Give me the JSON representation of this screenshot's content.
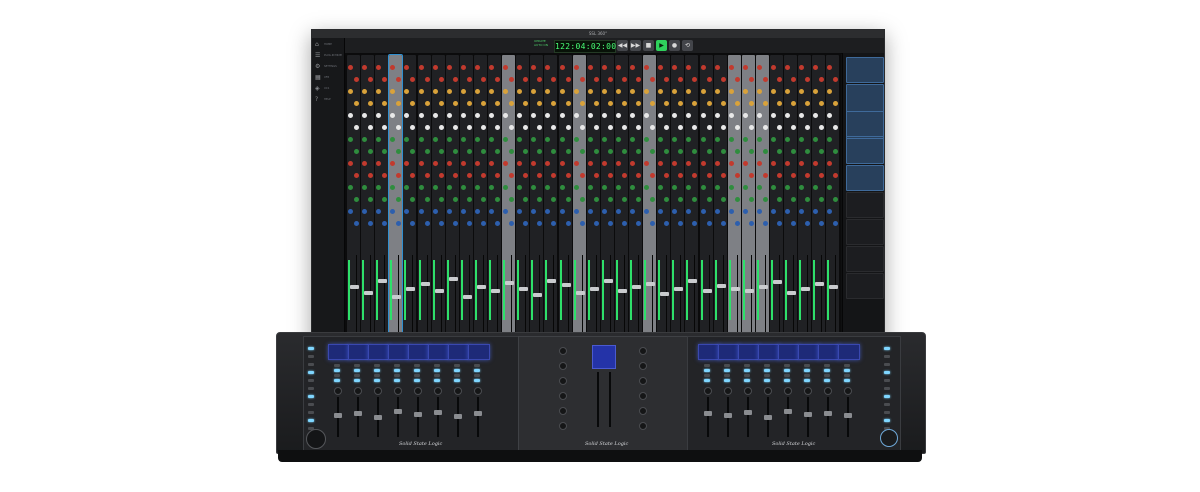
{
  "window": {
    "title": "SSL 360°"
  },
  "transport": {
    "timecode": "122:04:02:005",
    "flags": [
      "UPDATE",
      "AUTO ON"
    ],
    "buttons": [
      {
        "name": "rewind",
        "glyph": "◀◀",
        "active": false
      },
      {
        "name": "fast-forward",
        "glyph": "▶▶",
        "active": false
      },
      {
        "name": "stop",
        "glyph": "■",
        "active": false
      },
      {
        "name": "play",
        "glyph": "▶",
        "active": true
      },
      {
        "name": "record",
        "glyph": "●",
        "active": false
      },
      {
        "name": "loop",
        "glyph": "⟲",
        "active": false
      }
    ]
  },
  "sidebar": {
    "items": [
      {
        "icon": "home-icon",
        "glyph": "⌂",
        "label": "HOME"
      },
      {
        "icon": "mixer-icon",
        "glyph": "☰",
        "label": "PLUG-IN MIXER"
      },
      {
        "icon": "settings-icon",
        "glyph": "⚙",
        "label": "SETTINGS"
      },
      {
        "icon": "uf8-icon",
        "glyph": "▦",
        "label": "UF8"
      },
      {
        "icon": "uc1-icon",
        "glyph": "◈",
        "label": "UC1"
      },
      {
        "icon": "help-icon",
        "glyph": "?",
        "label": "HELP"
      }
    ]
  },
  "mixer": {
    "strip_shades": [
      "dark",
      "dark",
      "dark",
      "light",
      "dark",
      "dark",
      "dark",
      "dark",
      "dark",
      "dark",
      "dark",
      "light",
      "dark",
      "dark",
      "dark",
      "dark",
      "light",
      "dark",
      "dark",
      "dark",
      "dark",
      "light",
      "dark",
      "dark",
      "dark",
      "dark",
      "dark",
      "light",
      "light",
      "light",
      "dark",
      "dark",
      "dark",
      "dark",
      "dark"
    ],
    "selected_strip": 3,
    "knob_colors": [
      "#c23a2e",
      "#2f8d3e",
      "#2d5fae",
      "#e8e8e8",
      "#d9a23a"
    ],
    "fader_levels": [
      0.62,
      0.55,
      0.7,
      0.5,
      0.6,
      0.66,
      0.58,
      0.72,
      0.5,
      0.63,
      0.57,
      0.68,
      0.6,
      0.52,
      0.7,
      0.65,
      0.55,
      0.6,
      0.7,
      0.58,
      0.62,
      0.66,
      0.54,
      0.6,
      0.7,
      0.58,
      0.64,
      0.6,
      0.57,
      0.63,
      0.69,
      0.55,
      0.6,
      0.66,
      0.62
    ]
  },
  "plugin_panel": {
    "slots": [
      {
        "filled": true
      },
      {
        "filled": true
      },
      {
        "filled": true
      },
      {
        "filled": true
      },
      {
        "filled": true
      },
      {
        "filled": false
      },
      {
        "filled": false
      },
      {
        "filled": false
      },
      {
        "filled": false
      }
    ]
  },
  "hardware": {
    "brand_left": "Solid State Logic",
    "brand_center": "Solid State Logic",
    "brand_right": "Solid State Logic",
    "left_fader_levels": [
      0.55,
      0.6,
      0.5,
      0.65,
      0.58,
      0.62,
      0.52,
      0.6
    ],
    "right_fader_levels": [
      0.6,
      0.55,
      0.62,
      0.5,
      0.66,
      0.58,
      0.6,
      0.54
    ],
    "accent": "#7fd6ff",
    "lcd_color": "#1e2a78"
  }
}
